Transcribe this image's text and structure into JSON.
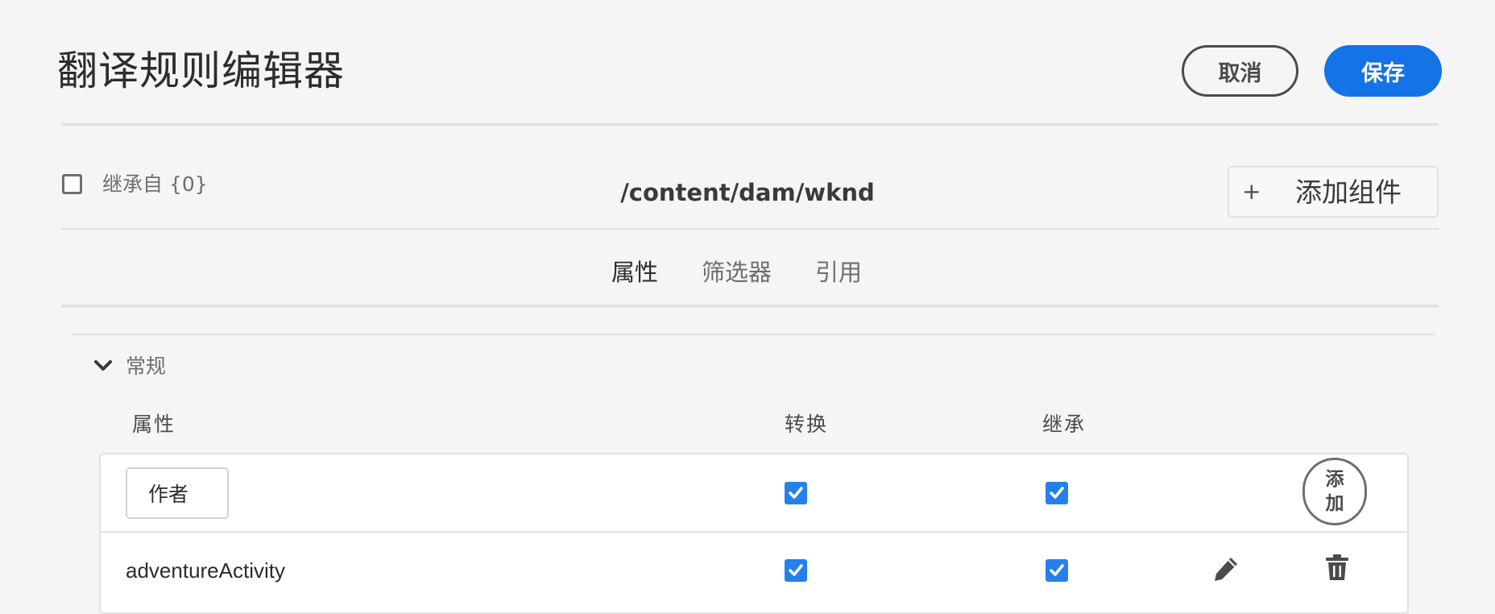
{
  "header": {
    "title": "翻译规则编辑器",
    "cancel_label": "取消",
    "save_label": "保存"
  },
  "inherit": {
    "label": "继承自 {0}",
    "checked": false
  },
  "path": "/content/dam/wknd",
  "add_component": {
    "icon": "+",
    "label": "添加组件"
  },
  "tabs": [
    {
      "label": "属性",
      "active": true
    },
    {
      "label": "筛选器",
      "active": false
    },
    {
      "label": "引用",
      "active": false
    }
  ],
  "section": {
    "title": "常规",
    "expanded": true
  },
  "table": {
    "columns": [
      "属性",
      "转换",
      "继承"
    ],
    "new_row": {
      "input_value": "作者",
      "translate": true,
      "inherit": true,
      "add_label_line1": "添",
      "add_label_line2": "加"
    },
    "rows": [
      {
        "name": "adventureActivity",
        "translate": true,
        "inherit": true
      }
    ]
  },
  "colors": {
    "accent": "#1473e6",
    "checkbox": "#2680eb",
    "background": "#f5f5f5"
  },
  "icons": {
    "edit": "pencil-icon",
    "delete": "trash-icon",
    "expand": "chevron-down-icon",
    "check": "checkmark-icon"
  }
}
